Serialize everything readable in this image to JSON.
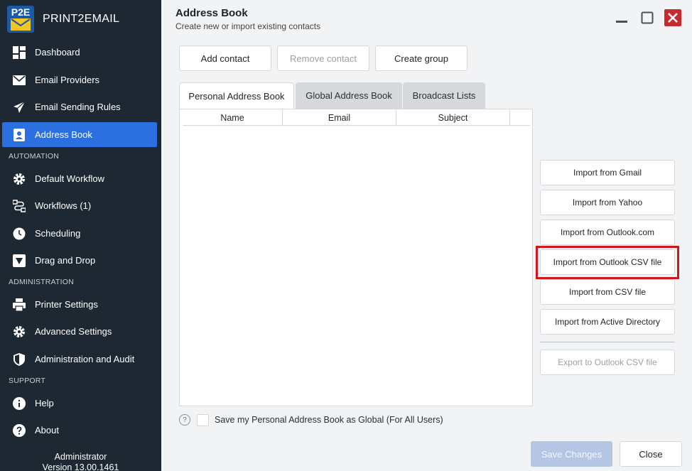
{
  "app": {
    "logo_text": "P2E",
    "name": "PRINT2EMAIL"
  },
  "sidebar": {
    "items": [
      {
        "label": "Dashboard",
        "icon": "dashboard-icon"
      },
      {
        "label": "Email Providers",
        "icon": "envelope-icon"
      },
      {
        "label": "Email Sending Rules",
        "icon": "send-icon"
      },
      {
        "label": "Address Book",
        "icon": "contact-card-icon",
        "active": true
      },
      {
        "label": "Default Workflow",
        "icon": "gear-icon"
      },
      {
        "label": "Workflows (1)",
        "icon": "workflow-icon"
      },
      {
        "label": "Scheduling",
        "icon": "clock-icon"
      },
      {
        "label": "Drag and Drop",
        "icon": "drop-arrow-icon"
      },
      {
        "label": "Printer Settings",
        "icon": "printer-icon"
      },
      {
        "label": "Advanced Settings",
        "icon": "gear-icon"
      },
      {
        "label": "Administration and Audit",
        "icon": "shield-icon"
      },
      {
        "label": "Help",
        "icon": "info-icon"
      },
      {
        "label": "About",
        "icon": "question-icon"
      }
    ],
    "sections": {
      "automation": "AUTOMATION",
      "administration": "ADMINISTRATION",
      "support": "SUPPORT"
    },
    "user": "Administrator",
    "version": "Version 13.00.1461"
  },
  "header": {
    "title": "Address Book",
    "subtitle": "Create new or import existing contacts"
  },
  "toolbar": {
    "add_contact": "Add contact",
    "remove_contact": "Remove contact",
    "create_group": "Create group"
  },
  "tabs": [
    {
      "label": "Personal Address Book",
      "active": true
    },
    {
      "label": "Global Address Book",
      "active": false
    },
    {
      "label": "Broadcast Lists",
      "active": false
    }
  ],
  "table": {
    "columns": [
      "Name",
      "Email",
      "Subject"
    ],
    "rows": []
  },
  "import_buttons": {
    "gmail": "Import from Gmail",
    "yahoo": "Import from Yahoo",
    "outlook_com": "Import from Outlook.com",
    "outlook_csv": "Import from Outlook CSV file",
    "csv": "Import from CSV file",
    "active_directory": "Import from Active Directory",
    "export_outlook_csv": "Export to Outlook CSV file"
  },
  "footer": {
    "help_glyph": "?",
    "global_checkbox_label": "Save my Personal Address Book as Global (For All Users)",
    "global_checked": false,
    "save_changes": "Save Changes",
    "close": "Close"
  },
  "colors": {
    "sidebar_bg": "#1e2832",
    "active_nav": "#2c6fe0",
    "highlight": "#d0171b",
    "close_window": "#c62a2f"
  }
}
